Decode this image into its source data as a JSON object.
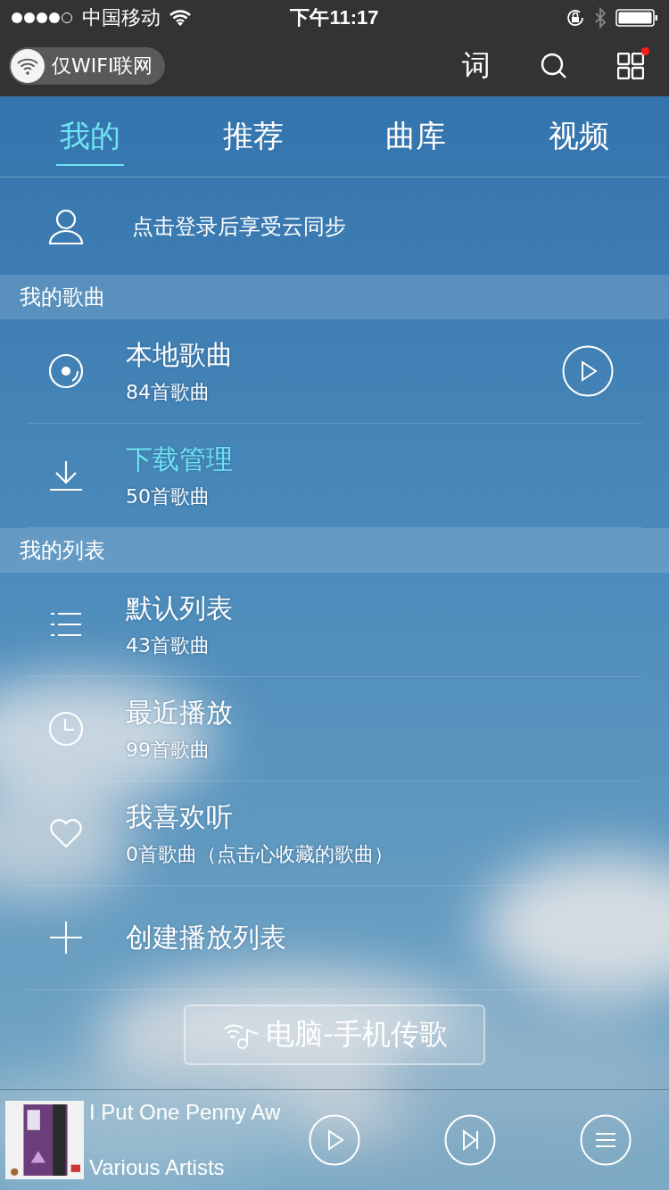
{
  "status_bar": {
    "carrier": "中国移动",
    "time": "下午11:17"
  },
  "top_bar": {
    "network_toggle": "仅WIFI联网",
    "lyrics_button": "词",
    "apps_badge": true
  },
  "tabs": [
    {
      "label": "我的",
      "selected": true
    },
    {
      "label": "推荐",
      "selected": false
    },
    {
      "label": "曲库",
      "selected": false
    },
    {
      "label": "视频",
      "selected": false
    }
  ],
  "login": {
    "text": "点击登录后享受云同步"
  },
  "sections": [
    {
      "title": "我的歌曲",
      "items": [
        {
          "kind": "disc",
          "title": "本地歌曲",
          "subtitle": "84首歌曲",
          "active": false,
          "play_button": true
        },
        {
          "kind": "download",
          "title": "下载管理",
          "subtitle": "50首歌曲",
          "active": true,
          "play_button": false
        }
      ]
    },
    {
      "title": "我的列表",
      "items": [
        {
          "kind": "list",
          "title": "默认列表",
          "subtitle": "43首歌曲",
          "active": false,
          "play_button": false
        },
        {
          "kind": "clock",
          "title": "最近播放",
          "subtitle": "99首歌曲",
          "active": false,
          "play_button": false
        },
        {
          "kind": "heart",
          "title": "我喜欢听",
          "subtitle": "0首歌曲（点击心收藏的歌曲）",
          "active": false,
          "play_button": false
        },
        {
          "kind": "add",
          "title": "创建播放列表",
          "active": false,
          "play_button": false
        }
      ]
    }
  ],
  "transfer_button": "电脑-手机传歌",
  "player": {
    "title": "I Put One Penny Aw",
    "artist": "Various Artists"
  }
}
